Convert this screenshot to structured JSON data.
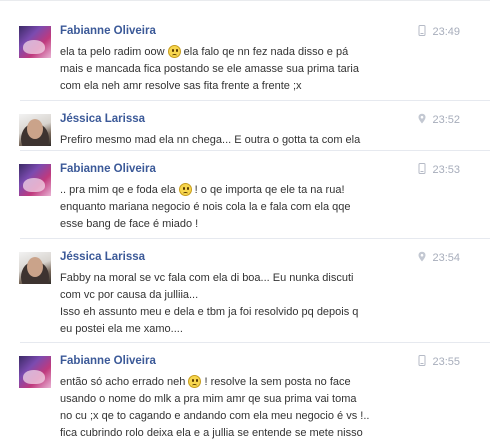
{
  "colors": {
    "name": "#3b5998",
    "meta": "#a7adbb",
    "text": "#333333"
  },
  "messages": [
    {
      "author": "Fabianne Oliveira",
      "device": "mobile-phone-icon",
      "time": "23:49",
      "lines": [
        [
          "ela ta pelo radim oow ",
          "emoji:sad-face",
          " ela falo qe nn fez nada disso e pá"
        ],
        [
          "mais e mancada fica postando se ele amasse sua prima taria"
        ],
        [
          "com ela neh amr resolve sas fita frente a frente ;x"
        ]
      ]
    },
    {
      "author": "Jéssica Larissa",
      "device": "location-pin-icon",
      "time": "23:52",
      "lines": [
        [
          "Prefiro mesmo mad ela nn chega... E outra o gotta ta com ela"
        ]
      ]
    },
    {
      "author": "Fabianne Oliveira",
      "device": "mobile-phone-icon",
      "time": "23:53",
      "lines": [
        [
          ".. pra mim qe e foda ela ",
          "emoji:sad-face",
          " ! o qe importa qe ele ta na rua!"
        ],
        [
          "enquanto mariana negocio é nois cola la e fala com ela qqe"
        ],
        [
          "esse bang de face é miado !"
        ]
      ]
    },
    {
      "author": "Jéssica Larissa",
      "device": "location-pin-icon",
      "time": "23:54",
      "lines": [
        [
          "Fabby na moral se vc fala com ela di boa... Eu nunka discuti"
        ],
        [
          "com vc por causa da julliia..."
        ],
        [
          "Isso eh assunto meu e dela e tbm ja foi resolvido pq depois q"
        ],
        [
          "eu postei ela me xamo...."
        ]
      ]
    },
    {
      "author": "Fabianne Oliveira",
      "device": "mobile-phone-icon",
      "time": "23:55",
      "lines": [
        [
          "então só acho errado neh ",
          "emoji:sad-face",
          " ! resolve la sem posta no face"
        ],
        [
          "usando o nome do mlk a pra mim amr qe sua prima vai toma"
        ],
        [
          "no cu ;x qe to cagando e andando com ela meu negocio é vs !.."
        ],
        [
          "fica cubrindo rolo deixa ela e a jullia se entende se mete nisso"
        ]
      ]
    }
  ]
}
